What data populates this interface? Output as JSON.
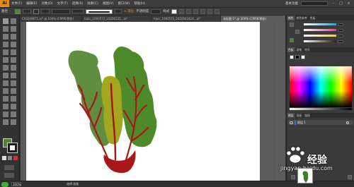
{
  "app": {
    "logo_text": "Ai"
  },
  "menu": [
    "文件(F)",
    "编辑(E)",
    "对象(O)",
    "文字(T)",
    "选择(S)",
    "效果(C)",
    "视图(V)",
    "窗口(W)",
    "帮助(H)"
  ],
  "menu_right": {
    "workspace": "基本功能"
  },
  "control_bar": {
    "label": "路径",
    "stroke_weight_label": "",
    "style_label": "不透明度",
    "doc_label": "样式",
    "orange_text": "< 等比",
    "fill_color": "#4b8a2b"
  },
  "tabs": [
    {
      "label": "C03209871.ai* @ 100% (CMYK/预览)",
      "active": false
    },
    {
      "label": "hipic_1093572_20200125...ai*",
      "active": false
    },
    {
      "label": "hipic_1093572_2020042424...ai*",
      "active": false
    },
    {
      "label": "未标题-1* @ 300% (CMYK/预览)",
      "active": true
    }
  ],
  "panels": {
    "top_tabs": [
      "颜色",
      "颜色参考",
      "色板"
    ],
    "swatch_tabs": [
      "色板",
      "画笔",
      "符号"
    ],
    "layers_tabs": [
      "图层",
      "画板",
      "链接"
    ],
    "layer_name": "图层 1",
    "slider_colors": [
      "#00b3ff",
      "#ff2fa8",
      "#ffd200",
      "#222222"
    ]
  },
  "status": {
    "zoom": "300%",
    "text": "选择 画板"
  },
  "watermark": {
    "brand": "经验",
    "url": "jingyan.baidu.com"
  },
  "colors": {
    "leaf_dark": "#5f8f3e",
    "leaf_mid": "#4e8a2a",
    "leaf_yellow": "#a3a61f",
    "stem_red": "#a8181a"
  }
}
